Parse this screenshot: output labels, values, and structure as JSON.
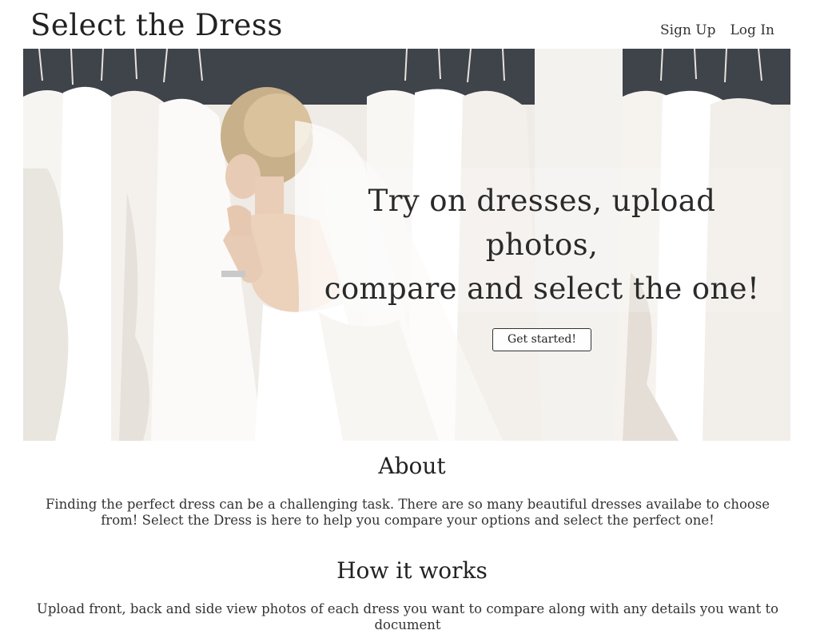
{
  "header": {
    "brand": "Select the Dress",
    "nav": {
      "sign_up": "Sign Up",
      "log_in": "Log In"
    }
  },
  "hero": {
    "image_description_icon": "bride-trying-on-dresses-photo",
    "title_line1": "Try on dresses, upload photos,",
    "title_line2": "compare and select the one!",
    "cta_label": "Get started!"
  },
  "about": {
    "title": "About",
    "text": "Finding the perfect dress can be a challenging task. There are so many beautiful dresses availabe to choose from! Select the Dress is here to help you compare your options and select the perfect one!"
  },
  "how_it_works": {
    "title": "How it works",
    "text": "Upload front, back and side view photos of each dress you want to compare along with any details you want to document"
  }
}
